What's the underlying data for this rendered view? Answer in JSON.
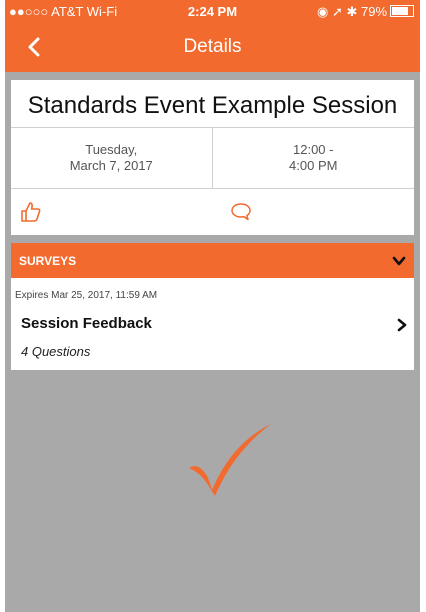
{
  "status_bar": {
    "carrier": "●●○○○ AT&T Wi-Fi",
    "time": "2:24 PM",
    "indicators": "◉ ➚ ✱ 79%"
  },
  "nav": {
    "title": "Details",
    "back_icon": "chevron-left-icon"
  },
  "session": {
    "title": "Standards Event Example Session",
    "day": "Tuesday,",
    "date": "March 7, 2017",
    "time_start": "12:00 -",
    "time_end": "4:00 PM",
    "like_icon": "thumbs-up-icon",
    "comment_icon": "comment-icon"
  },
  "surveys": {
    "header_label": "SURVEYS",
    "items": [
      {
        "expires": "Expires Mar 25, 2017, 11:59 AM",
        "name": "Session Feedback",
        "questions": "4 Questions"
      }
    ]
  },
  "colors": {
    "accent": "#f26a2e",
    "background": "#a9a9a9",
    "card": "#ffffff"
  }
}
